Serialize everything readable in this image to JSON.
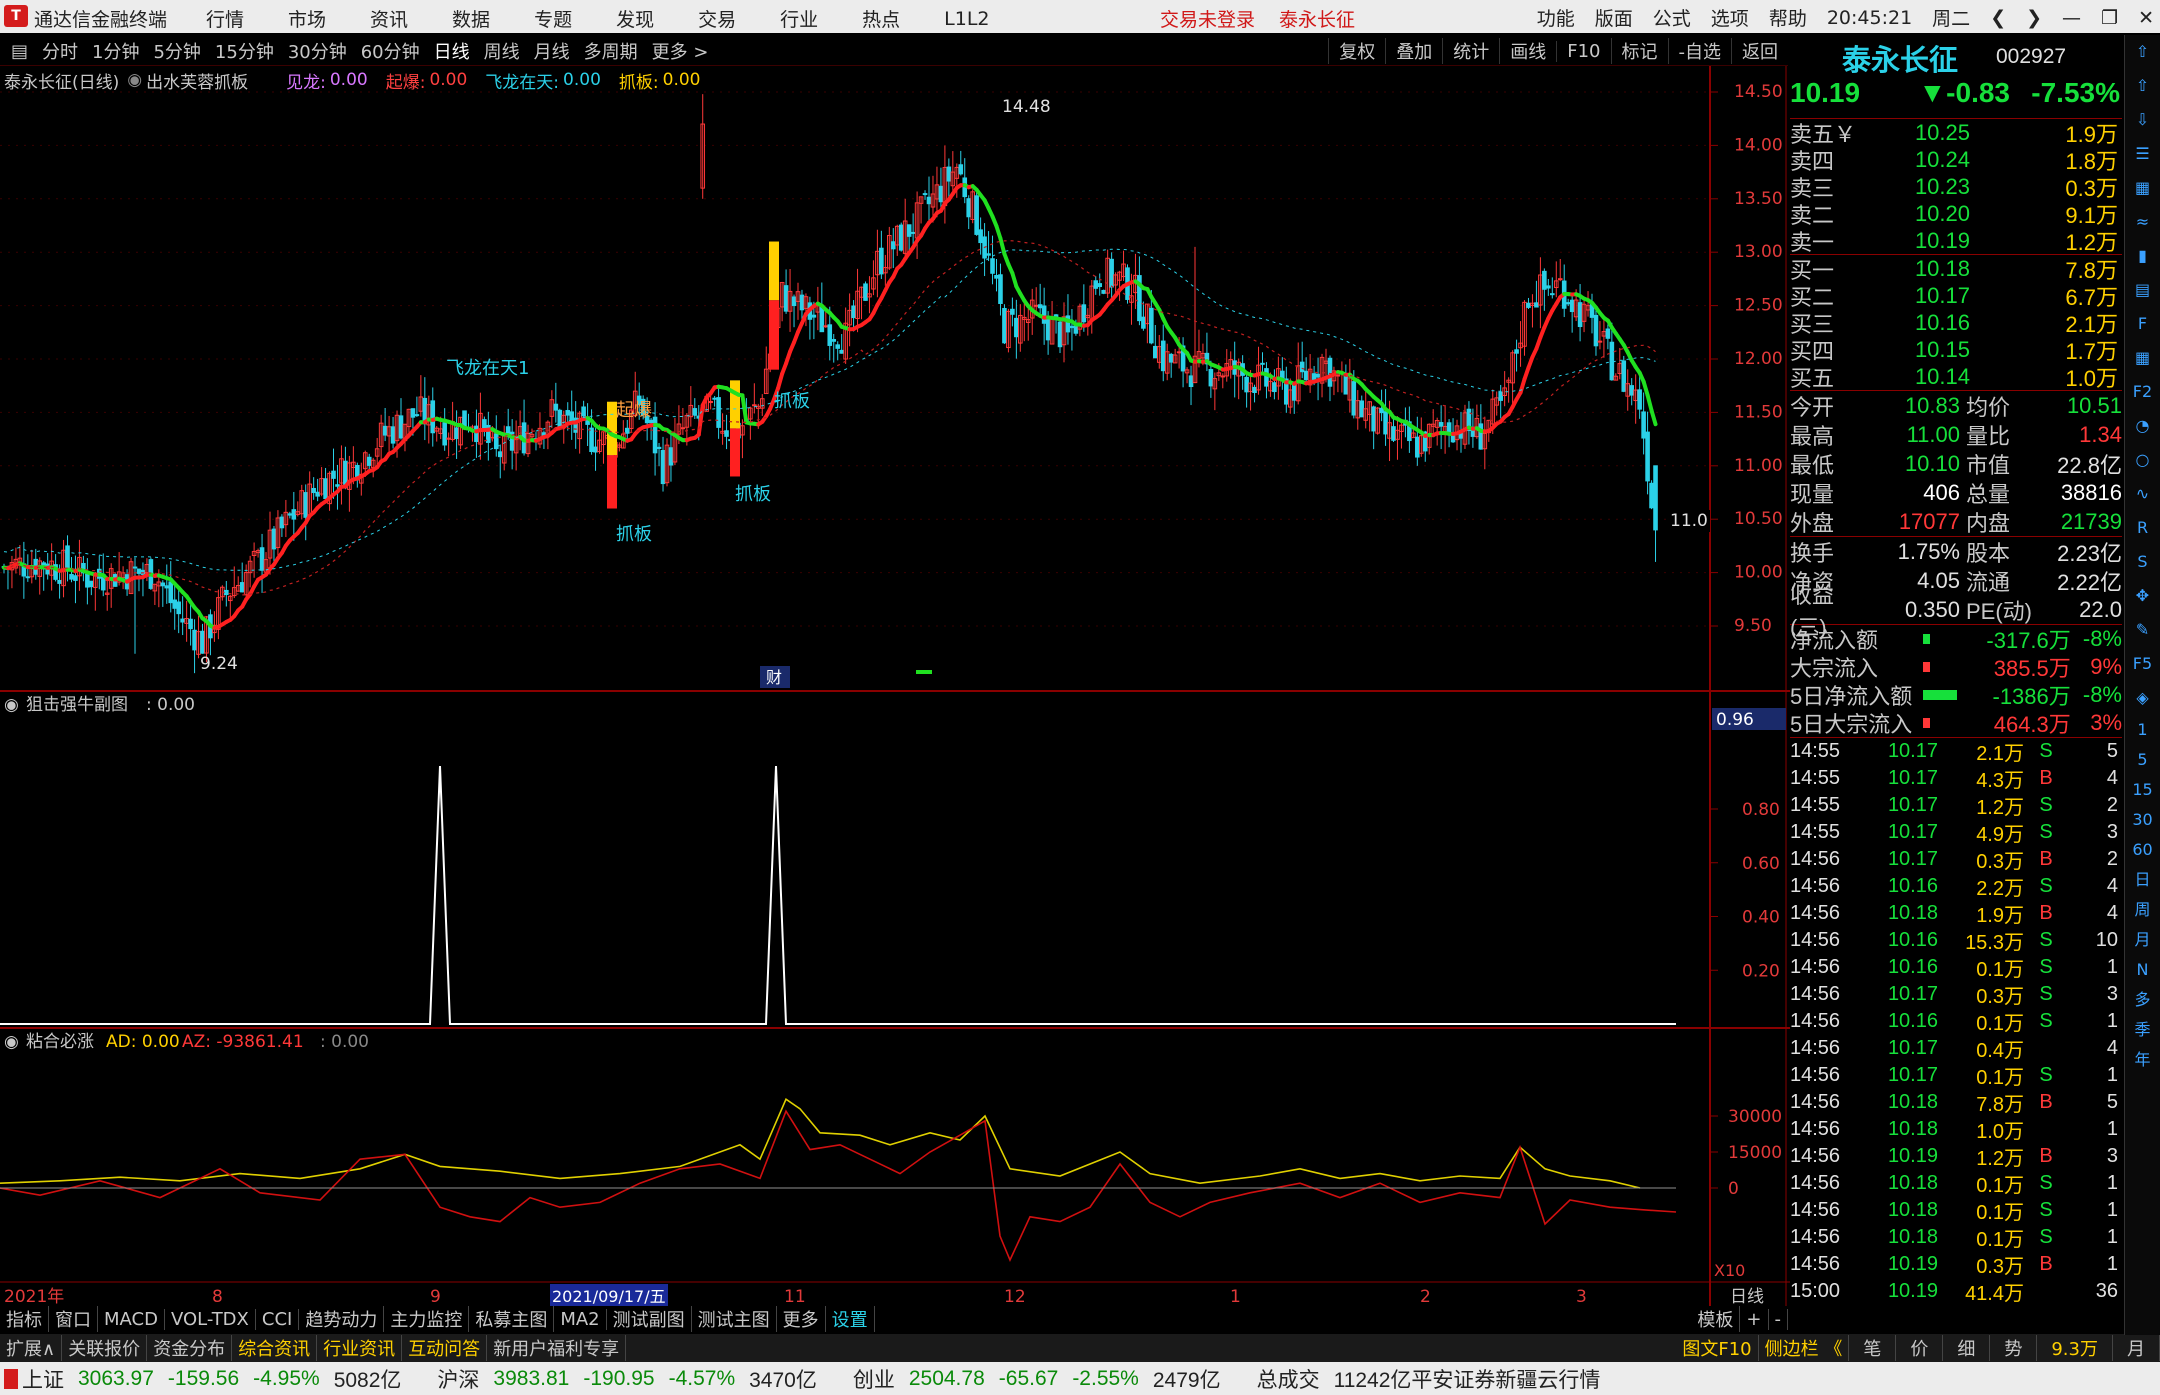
{
  "app": {
    "logo": "T",
    "title": "通达信金融终端",
    "menu": [
      "行情",
      "市场",
      "资讯",
      "数据",
      "专题",
      "发现",
      "交易",
      "行业",
      "热点",
      "L1L2"
    ],
    "trade_status": "交易未登录",
    "current_stock_tab": "泰永长征",
    "right_menu": [
      "功能",
      "版面",
      "公式",
      "选项",
      "帮助"
    ],
    "time": "20:45:21",
    "weekday": "周二"
  },
  "period_bar": {
    "periods": [
      "分时",
      "1分钟",
      "5分钟",
      "15分钟",
      "30分钟",
      "60分钟",
      "日线",
      "周线",
      "月线",
      "多周期",
      "更多 >"
    ],
    "active": "日线",
    "tools": [
      "复权",
      "叠加",
      "统计",
      "画线",
      "F10",
      "标记",
      "-自选",
      "返回"
    ]
  },
  "chart_header": {
    "name": "泰永长征(日线)",
    "formula": "出水芙蓉抓板",
    "items": [
      {
        "label": "见龙:",
        "value": "0.00",
        "color": "#d878ff"
      },
      {
        "label": "起爆:",
        "value": "0.00",
        "color": "#ff4040"
      },
      {
        "label": "飞龙在天:",
        "value": "0.00",
        "color": "#2bd1e8"
      },
      {
        "label": "抓板:",
        "value": "0.00",
        "color": "#ffd000"
      }
    ]
  },
  "main_chart": {
    "y_ticks": [
      "14.50",
      "14.00",
      "13.50",
      "13.00",
      "12.50",
      "12.00",
      "11.50",
      "11.00",
      "10.50",
      "10.00",
      "9.50"
    ],
    "high_label": "14.48",
    "low_label": "9.24",
    "last_label": "11.0",
    "annotations": [
      "飞龙在天1",
      "起爆",
      "抓板",
      "抓板",
      "抓板",
      "抓板"
    ],
    "cai_label": "财"
  },
  "sub1": {
    "title": "狙击强牛副图",
    "value": ": 0.00",
    "current": "0.96",
    "y_ticks": [
      "0.80",
      "0.60",
      "0.40",
      "0.20"
    ]
  },
  "sub2": {
    "title": "粘合必涨",
    "ad_label": "AD: 0.00",
    "az_label": "AZ: -93861.41",
    "extra": ": 0.00",
    "y_ticks": [
      "30000",
      "15000",
      "0"
    ],
    "scale": "X10"
  },
  "x_axis": {
    "labels": [
      "2021年",
      "8",
      "9",
      "2021/09/17/五",
      "11",
      "12",
      "1",
      "2",
      "3"
    ],
    "period": "日线"
  },
  "tabbar": {
    "items": [
      "指标",
      "窗口",
      "MACD",
      "VOL-TDX",
      "CCI",
      "趋势动力",
      "主力监控",
      "私募主图",
      "MA2",
      "测试副图",
      "测试主图",
      "更多",
      "设置"
    ],
    "selected": "设置",
    "right": [
      "模板",
      "+",
      "-"
    ]
  },
  "funcbar": {
    "items": [
      "扩展∧",
      "关联报价",
      "资金分布",
      "综合资讯",
      "行业资讯",
      "互动问答",
      "新用户福利专享"
    ],
    "right": [
      "图文F10",
      "侧边栏 《",
      "笔",
      "价",
      "细",
      "势",
      "9.3万",
      "月"
    ]
  },
  "statusbar": {
    "indices": [
      {
        "name": "上证",
        "value": "3063.97",
        "change": "-159.56",
        "pct": "-4.95%",
        "amount": "5082亿"
      },
      {
        "name": "沪深",
        "value": "3983.81",
        "change": "-190.95",
        "pct": "-4.57%",
        "amount": "3470亿"
      },
      {
        "name": "创业",
        "value": "2504.78",
        "change": "-65.67",
        "pct": "-2.55%",
        "amount": "2479亿"
      }
    ],
    "total_label": "总成交",
    "total_value": "11242亿",
    "broker": "平安证券新疆云行情"
  },
  "quote": {
    "name": "泰永长征",
    "code": "002927",
    "price": "10.19",
    "change": "▼-0.83",
    "pct": "-7.53%",
    "asks": [
      {
        "label": "卖五￥",
        "price": "10.25",
        "vol": "1.9万"
      },
      {
        "label": "卖四",
        "price": "10.24",
        "vol": "1.8万"
      },
      {
        "label": "卖三",
        "price": "10.23",
        "vol": "0.3万"
      },
      {
        "label": "卖二",
        "price": "10.20",
        "vol": "9.1万"
      },
      {
        "label": "卖一",
        "price": "10.19",
        "vol": "1.2万"
      }
    ],
    "bids": [
      {
        "label": "买一",
        "price": "10.18",
        "vol": "7.8万"
      },
      {
        "label": "买二",
        "price": "10.17",
        "vol": "6.7万"
      },
      {
        "label": "买三",
        "price": "10.16",
        "vol": "2.1万"
      },
      {
        "label": "买四",
        "price": "10.15",
        "vol": "1.7万"
      },
      {
        "label": "买五",
        "price": "10.14",
        "vol": "1.0万"
      }
    ],
    "info": [
      {
        "l1": "今开",
        "v1": "10.83",
        "c1": "#16e03b",
        "l2": "均价",
        "v2": "10.51",
        "c2": "#16e03b"
      },
      {
        "l1": "最高",
        "v1": "11.00",
        "c1": "#16e03b",
        "l2": "量比",
        "v2": "1.34",
        "c2": "#ff3838"
      },
      {
        "l1": "最低",
        "v1": "10.10",
        "c1": "#16e03b",
        "l2": "市值",
        "v2": "22.8亿",
        "c2": "#e0e0e0"
      },
      {
        "l1": "现量",
        "v1": "406",
        "c1": "#ffffff",
        "l2": "总量",
        "v2": "38816",
        "c2": "#ffffff"
      },
      {
        "l1": "外盘",
        "v1": "17077",
        "c1": "#ff3838",
        "l2": "内盘",
        "v2": "21739",
        "c2": "#16e03b"
      }
    ],
    "info2": [
      {
        "l1": "换手",
        "v1": "1.75%",
        "l2": "股本",
        "v2": "2.23亿"
      },
      {
        "l1": "净资",
        "v1": "4.05",
        "l2": "流通",
        "v2": "2.22亿"
      },
      {
        "l1": "收益(三)",
        "v1": "0.350",
        "l2": "PE(动)",
        "v2": "22.0"
      }
    ],
    "flows": [
      {
        "label": "净流入额",
        "bar": "green",
        "value": "-317.6万",
        "pct": "-8%",
        "vc": "#16e03b"
      },
      {
        "label": "大宗流入",
        "bar": "red",
        "value": "385.5万",
        "pct": "9%",
        "vc": "#ff3838"
      },
      {
        "label": "5日净流入额",
        "bar": "green-wide",
        "value": "-1386万",
        "pct": "-8%",
        "vc": "#16e03b"
      },
      {
        "label": "5日大宗流入",
        "bar": "red",
        "value": "464.3万",
        "pct": "3%",
        "vc": "#ff3838"
      }
    ],
    "ticks": [
      {
        "t": "14:55",
        "p": "10.17",
        "v": "2.1万",
        "bs": "S",
        "n": "5"
      },
      {
        "t": "14:55",
        "p": "10.17",
        "v": "4.3万",
        "bs": "B",
        "n": "4"
      },
      {
        "t": "14:55",
        "p": "10.17",
        "v": "1.2万",
        "bs": "S",
        "n": "2"
      },
      {
        "t": "14:55",
        "p": "10.17",
        "v": "4.9万",
        "bs": "S",
        "n": "3"
      },
      {
        "t": "14:56",
        "p": "10.17",
        "v": "0.3万",
        "bs": "B",
        "n": "2"
      },
      {
        "t": "14:56",
        "p": "10.16",
        "v": "2.2万",
        "bs": "S",
        "n": "4"
      },
      {
        "t": "14:56",
        "p": "10.18",
        "v": "1.9万",
        "bs": "B",
        "n": "4"
      },
      {
        "t": "14:56",
        "p": "10.16",
        "v": "15.3万",
        "bs": "S",
        "n": "10"
      },
      {
        "t": "14:56",
        "p": "10.16",
        "v": "0.1万",
        "bs": "S",
        "n": "1"
      },
      {
        "t": "14:56",
        "p": "10.17",
        "v": "0.3万",
        "bs": "S",
        "n": "3"
      },
      {
        "t": "14:56",
        "p": "10.16",
        "v": "0.1万",
        "bs": "S",
        "n": "1"
      },
      {
        "t": "14:56",
        "p": "10.17",
        "v": "0.4万",
        "bs": "",
        "n": "4"
      },
      {
        "t": "14:56",
        "p": "10.17",
        "v": "0.1万",
        "bs": "S",
        "n": "1"
      },
      {
        "t": "14:56",
        "p": "10.18",
        "v": "7.8万",
        "bs": "B",
        "n": "5"
      },
      {
        "t": "14:56",
        "p": "10.18",
        "v": "1.0万",
        "bs": "",
        "n": "1"
      },
      {
        "t": "14:56",
        "p": "10.19",
        "v": "1.2万",
        "bs": "B",
        "n": "3"
      },
      {
        "t": "14:56",
        "p": "10.18",
        "v": "0.1万",
        "bs": "S",
        "n": "1"
      },
      {
        "t": "14:56",
        "p": "10.18",
        "v": "0.1万",
        "bs": "S",
        "n": "1"
      },
      {
        "t": "14:56",
        "p": "10.18",
        "v": "0.1万",
        "bs": "S",
        "n": "1"
      },
      {
        "t": "14:56",
        "p": "10.19",
        "v": "0.3万",
        "bs": "B",
        "n": "1"
      },
      {
        "t": "15:00",
        "p": "10.19",
        "v": "41.4万",
        "bs": "",
        "n": "36"
      }
    ]
  },
  "icon_column": [
    "arrow-up-icon",
    "arrow-up-icon",
    "arrow-down-icon",
    "list-icon",
    "grid-icon",
    "chart-line-icon",
    "candles-icon",
    "doc-icon",
    "f10-icon",
    "table-icon",
    "f2-icon",
    "gauge-icon",
    "circle-icon",
    "wave-icon",
    "rsi-icon",
    "s-icon",
    "move-icon",
    "pen-icon",
    "f5-icon",
    "money-icon"
  ],
  "icon_column_periods": [
    "1",
    "5",
    "15",
    "30",
    "60",
    "日",
    "周",
    "月",
    "N",
    "多",
    "季",
    "年"
  ],
  "colors": {
    "up": "#ff3838",
    "down": "#16e03b",
    "ma_up": "#ff2020",
    "ma_down": "#20e020",
    "cyan": "#2bd1e8",
    "yellow": "#ffd000",
    "axis": "#8a0000"
  }
}
